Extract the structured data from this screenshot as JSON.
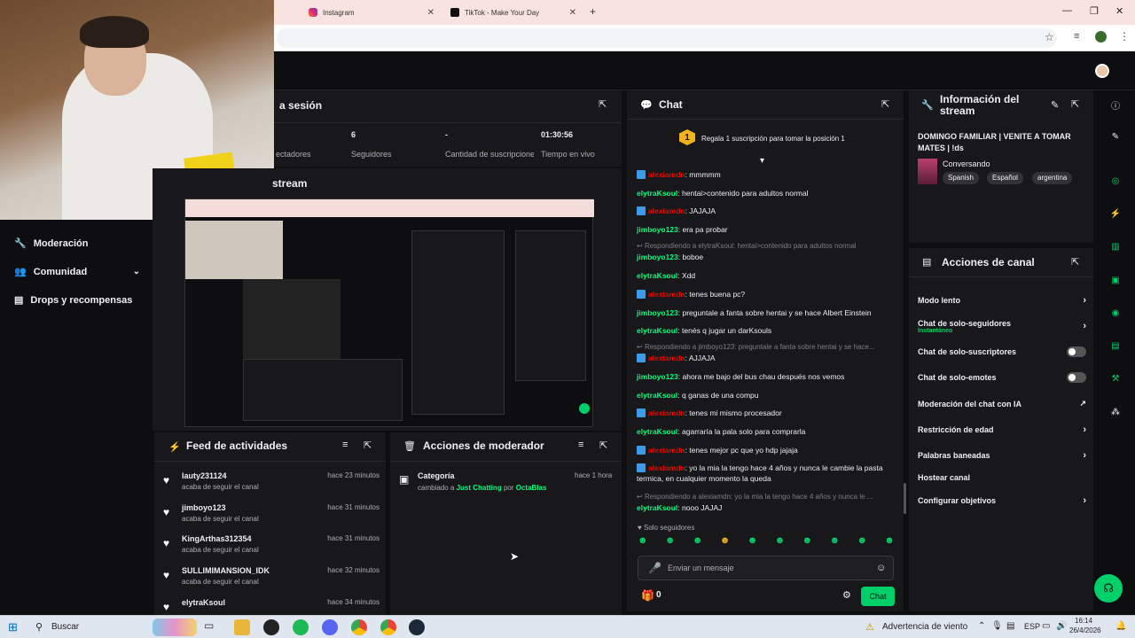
{
  "browser": {
    "tabs": [
      {
        "label": "Instagram",
        "icon": "instagram-icon"
      },
      {
        "label": "TikTok - Make Your Day",
        "icon": "tiktok-icon"
      }
    ],
    "new_tab": "+"
  },
  "stats": {
    "title_fragment": "a sesión",
    "items": [
      {
        "value": "",
        "label": "ectadores"
      },
      {
        "value": "6",
        "label": "Seguidores"
      },
      {
        "value": "-",
        "label": "Cantidad de suscripciones"
      },
      {
        "value": "01:30:56",
        "label": "Tiempo en vivo"
      }
    ]
  },
  "preview": {
    "title_fragment": "stream"
  },
  "sidebar": {
    "items": [
      {
        "label": "Moderación",
        "icon": "wrench-icon"
      },
      {
        "label": "Comunidad",
        "icon": "community-icon"
      },
      {
        "label": "Drops y recompensas",
        "icon": "drops-icon"
      }
    ]
  },
  "feed": {
    "title": "Feed de actividades",
    "rows": [
      {
        "name": "lauty231124",
        "sub": "acaba de seguir el canal",
        "time": "hace 23 minutos"
      },
      {
        "name": "jimboyo123",
        "sub": "acaba de seguir el canal",
        "time": "hace 31 minutos"
      },
      {
        "name": "KingArthas312354",
        "sub": "acaba de seguir el canal",
        "time": "hace 31 minutos"
      },
      {
        "name": "SULLIMIMANSION_IDK",
        "sub": "acaba de seguir el canal",
        "time": "hace 32 minutos"
      },
      {
        "name": "elytraKsoul",
        "sub": "",
        "time": "hace 34 minutos"
      }
    ]
  },
  "mod_actions": {
    "title": "Acciones de moderador",
    "item": {
      "title": "Categoría",
      "pre": "cambiado a",
      "category": "Just Chatting",
      "by": "por",
      "user": "OctaBlas",
      "time": "hace 1 hora"
    }
  },
  "chat": {
    "title": "Chat",
    "promo_rank": "1",
    "promo": "Regala 1 suscripción para tomar la posición 1",
    "messages": [
      {
        "user": "alexiamdn",
        "color": "#eb0400",
        "badge": true,
        "text": ": mmmmm"
      },
      {
        "user": "elytraKsoul",
        "color": "#00ff7f",
        "badge": false,
        "text": ": hentai>contenido para adultos normal"
      },
      {
        "user": "alexiamdn",
        "color": "#eb0400",
        "badge": true,
        "text": ": JAJAJA"
      },
      {
        "user": "jimboyo123",
        "color": "#00ff7f",
        "badge": false,
        "text": ": era pa probar"
      },
      {
        "reply": "Respondiendo a elytraKsoul: hentai>contenido para adultos normal"
      },
      {
        "user": "jimboyo123",
        "color": "#00ff7f",
        "badge": false,
        "text": ": boboe"
      },
      {
        "user": "elytraKsoul",
        "color": "#00ff7f",
        "badge": false,
        "text": ": Xdd"
      },
      {
        "user": "alexiamdn",
        "color": "#eb0400",
        "badge": true,
        "text": ": tenes buena pc?"
      },
      {
        "user": "jimboyo123",
        "color": "#00ff7f",
        "badge": false,
        "text": ": preguntale a fanta sobre hentai y se hace Albert Einstein"
      },
      {
        "user": "elytraKsoul",
        "color": "#00ff7f",
        "badge": false,
        "text": ": tenés q jugar un darKsouls"
      },
      {
        "reply": "Respondiendo a jimboyo123: preguntale a fanta sobre hentai y se hace..."
      },
      {
        "user": "alexiamdn",
        "color": "#eb0400",
        "badge": true,
        "text": ": AJJAJA"
      },
      {
        "user": "jimboyo123",
        "color": "#00ff7f",
        "badge": false,
        "text": ": ahora me bajo del bus chau después nos vemos"
      },
      {
        "user": "elytraKsoul",
        "color": "#00ff7f",
        "badge": false,
        "text": ": q ganas de una compu"
      },
      {
        "user": "alexiamdn",
        "color": "#eb0400",
        "badge": true,
        "text": ": tenes mi mismo procesador"
      },
      {
        "user": "elytraKsoul",
        "color": "#00ff7f",
        "badge": false,
        "text": ": agarraría la pala solo para comprarla"
      },
      {
        "user": "alexiamdn",
        "color": "#eb0400",
        "badge": true,
        "text": ": tenes mejor pc que yo hdp jajaja"
      },
      {
        "user": "alexiamdn",
        "color": "#eb0400",
        "badge": true,
        "text": ": yo la mia la tengo hace 4 años y nunca le cambie la pasta termica, en cualquier momento la queda"
      },
      {
        "reply": "Respondiendo a alexiamdn: yo la mia la tengo hace 4 años y nunca le ..."
      },
      {
        "user": "elytraKsoul",
        "color": "#00ff7f",
        "badge": false,
        "text": ": nooo JAJAJ"
      }
    ],
    "followers_only": "Solo seguidores",
    "input_placeholder": "Enviar un mensaje",
    "points": "0",
    "send": "Chat"
  },
  "stream_info": {
    "title": "Información del stream",
    "stream_title": "DOMINGO FAMILIAR | VENITE A TOMAR MATES | !ds",
    "category": "Conversando",
    "tags": [
      "Spanish",
      "Español",
      "argentina"
    ]
  },
  "channel_actions": {
    "title": "Acciones de canal",
    "items": [
      {
        "label": "Modo lento",
        "type": "chevron"
      },
      {
        "label": "Chat de solo-seguidores",
        "sub": "Instantáneo",
        "type": "chevron"
      },
      {
        "label": "Chat de solo-suscriptores",
        "type": "toggle"
      },
      {
        "label": "Chat de solo-emotes",
        "type": "toggle"
      },
      {
        "label": "Moderación del chat con IA",
        "type": "external"
      },
      {
        "label": "Restricción de edad",
        "type": "chevron"
      },
      {
        "label": "Palabras baneadas",
        "type": "chevron"
      },
      {
        "label": "Hostear canal",
        "type": "none"
      },
      {
        "label": "Configurar objetivos",
        "type": "chevron"
      }
    ]
  },
  "taskbar": {
    "search": "Buscar",
    "weather": "Advertencia de viento",
    "lang": "ESP",
    "time": "16:14",
    "date": "26/4/2026"
  },
  "colors": {
    "accent": "#00d06a",
    "bg": "#0e0e10",
    "panel": "#18181b",
    "mod_red": "#eb0400",
    "user_green": "#00ff7f"
  }
}
